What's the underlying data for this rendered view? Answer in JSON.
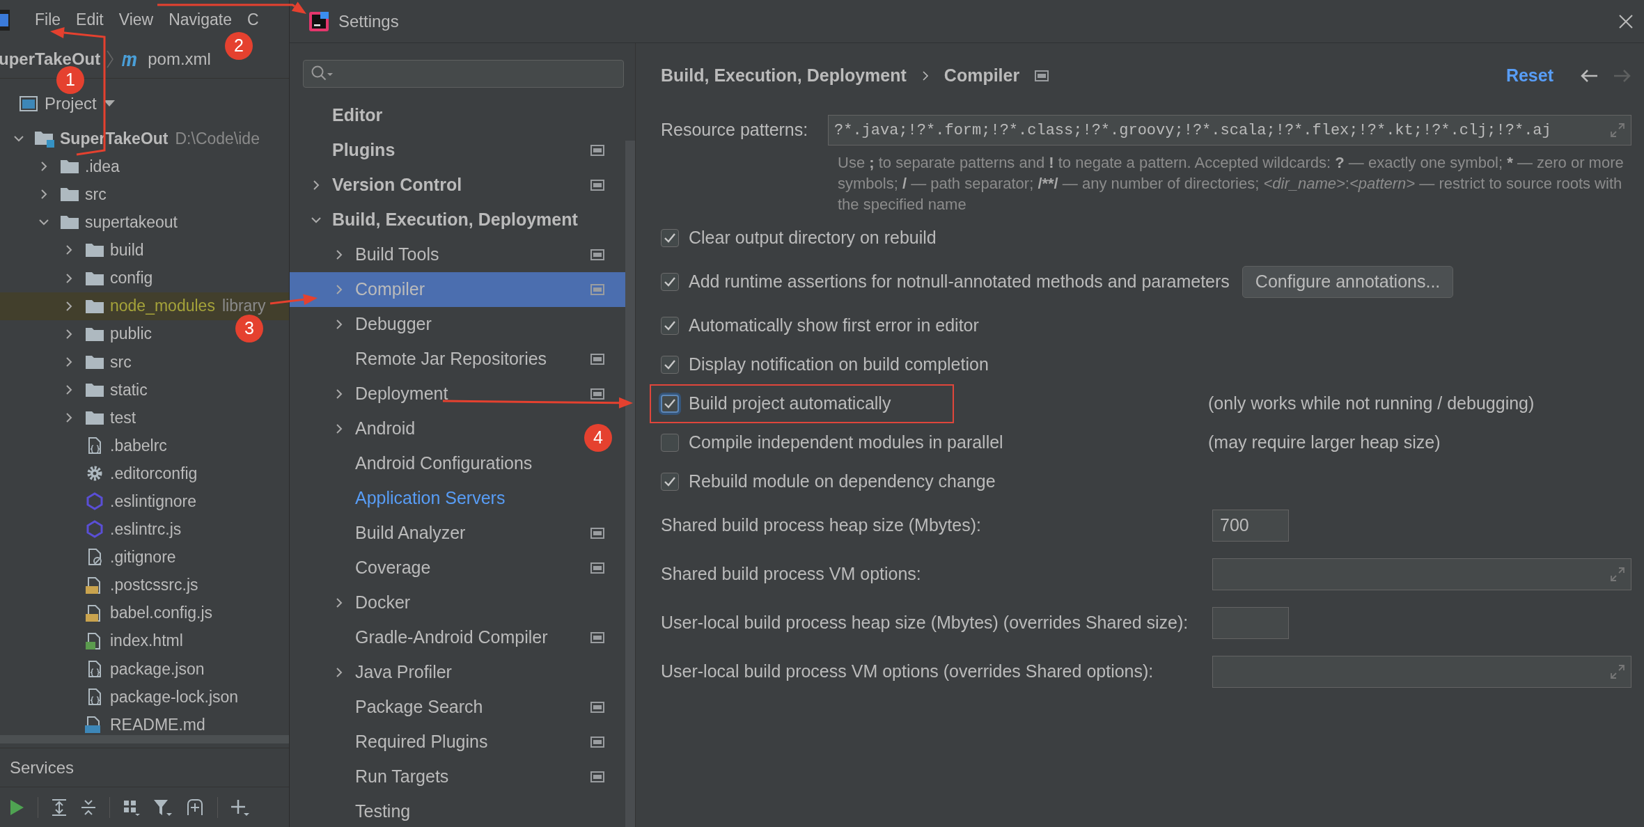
{
  "ide": {
    "menu": [
      "File",
      "Edit",
      "View",
      "Navigate",
      "C"
    ],
    "breadcrumb": {
      "project": "uperTakeOut",
      "file": "pom.xml"
    },
    "project_view": {
      "title": "Project"
    },
    "tree": [
      {
        "name": "SuperTakeOut",
        "path": "D:\\Code\\ide",
        "kind": "module",
        "expanded": true,
        "children": [
          {
            "name": ".idea",
            "kind": "folder",
            "expanded": false
          },
          {
            "name": "src",
            "kind": "folder",
            "expanded": false
          },
          {
            "name": "supertakeout",
            "kind": "folder",
            "expanded": true,
            "children": [
              {
                "name": "build",
                "kind": "folder",
                "expanded": false
              },
              {
                "name": "config",
                "kind": "folder",
                "expanded": false
              },
              {
                "name": "node_modules",
                "note": "library",
                "kind": "library",
                "expanded": false
              },
              {
                "name": "public",
                "kind": "folder",
                "expanded": false
              },
              {
                "name": "src",
                "kind": "folder",
                "expanded": false
              },
              {
                "name": "static",
                "kind": "folder",
                "expanded": false
              },
              {
                "name": "test",
                "kind": "folder",
                "expanded": false
              },
              {
                "name": ".babelrc",
                "kind": "config-file"
              },
              {
                "name": ".editorconfig",
                "kind": "gear"
              },
              {
                "name": ".eslintignore",
                "kind": "eslint"
              },
              {
                "name": ".eslintrc.js",
                "kind": "eslint"
              },
              {
                "name": ".gitignore",
                "kind": "ignore-file"
              },
              {
                "name": ".postcssrc.js",
                "kind": "js-file"
              },
              {
                "name": "babel.config.js",
                "kind": "js-file"
              },
              {
                "name": "index.html",
                "kind": "html-file"
              },
              {
                "name": "package.json",
                "kind": "config-file"
              },
              {
                "name": "package-lock.json",
                "kind": "config-file"
              },
              {
                "name": "README.md",
                "kind": "md-file"
              }
            ]
          }
        ]
      }
    ],
    "services": {
      "title": "Services"
    }
  },
  "dialog": {
    "title": "Settings",
    "sidebar": [
      {
        "label": "Editor",
        "bold": true,
        "scoped": false,
        "selected": false,
        "modified": false
      },
      {
        "label": "Plugins",
        "bold": true,
        "scoped": true,
        "selected": false,
        "modified": false
      },
      {
        "label": "Version Control",
        "bold": true,
        "scoped": true,
        "selected": false,
        "modified": false,
        "expanded": false
      },
      {
        "label": "Build, Execution, Deployment",
        "bold": true,
        "scoped": false,
        "selected": false,
        "modified": false,
        "expanded": true,
        "children": [
          {
            "label": "Build Tools",
            "bold": false,
            "scoped": true,
            "selected": false,
            "modified": false,
            "expanded": false
          },
          {
            "label": "Compiler",
            "bold": false,
            "scoped": true,
            "selected": true,
            "modified": false,
            "expanded": false
          },
          {
            "label": "Debugger",
            "bold": false,
            "scoped": false,
            "selected": false,
            "modified": false,
            "expanded": false
          },
          {
            "label": "Remote Jar Repositories",
            "bold": false,
            "scoped": true,
            "selected": false,
            "modified": false
          },
          {
            "label": "Deployment",
            "bold": false,
            "scoped": true,
            "selected": false,
            "modified": false,
            "expanded": false
          },
          {
            "label": "Android",
            "bold": false,
            "scoped": false,
            "selected": false,
            "modified": false,
            "expanded": false
          },
          {
            "label": "Android Configurations",
            "bold": false,
            "scoped": false,
            "selected": false,
            "modified": false
          },
          {
            "label": "Application Servers",
            "bold": false,
            "scoped": false,
            "selected": false,
            "modified": true
          },
          {
            "label": "Build Analyzer",
            "bold": false,
            "scoped": true,
            "selected": false,
            "modified": false
          },
          {
            "label": "Coverage",
            "bold": false,
            "scoped": true,
            "selected": false,
            "modified": false
          },
          {
            "label": "Docker",
            "bold": false,
            "scoped": false,
            "selected": false,
            "modified": false,
            "expanded": false
          },
          {
            "label": "Gradle-Android Compiler",
            "bold": false,
            "scoped": true,
            "selected": false,
            "modified": false
          },
          {
            "label": "Java Profiler",
            "bold": false,
            "scoped": false,
            "selected": false,
            "modified": false,
            "expanded": false
          },
          {
            "label": "Package Search",
            "bold": false,
            "scoped": true,
            "selected": false,
            "modified": false
          },
          {
            "label": "Required Plugins",
            "bold": false,
            "scoped": true,
            "selected": false,
            "modified": false
          },
          {
            "label": "Run Targets",
            "bold": false,
            "scoped": true,
            "selected": false,
            "modified": false
          },
          {
            "label": "Testing",
            "bold": false,
            "scoped": false,
            "selected": false,
            "modified": false
          }
        ]
      }
    ],
    "page": {
      "breadcrumb": [
        "Build, Execution, Deployment",
        "Compiler"
      ],
      "reset": "Reset",
      "back_disabled": false,
      "forward_disabled": true,
      "resource_patterns": {
        "label": "Resource patterns:",
        "value": "?*.java;!?*.form;!?*.class;!?*.groovy;!?*.scala;!?*.flex;!?*.kt;!?*.clj;!?*.aj",
        "hint": [
          {
            "kind": "plain",
            "text": "Use "
          },
          {
            "kind": "bold",
            "text": ";"
          },
          {
            "kind": "plain",
            "text": " to separate patterns and "
          },
          {
            "kind": "bold",
            "text": "!"
          },
          {
            "kind": "plain",
            "text": " to negate a pattern. Accepted wildcards: "
          },
          {
            "kind": "bold",
            "text": "?"
          },
          {
            "kind": "plain",
            "text": " — exactly one symbol; "
          },
          {
            "kind": "bold",
            "text": "*"
          },
          {
            "kind": "plain",
            "text": " — zero or more symbols; "
          },
          {
            "kind": "bold",
            "text": "/"
          },
          {
            "kind": "plain",
            "text": " — path separator; "
          },
          {
            "kind": "bold",
            "text": "/**/"
          },
          {
            "kind": "plain",
            "text": " — any number of directories; "
          },
          {
            "kind": "italic",
            "text": "<dir_name>"
          },
          {
            "kind": "plain",
            "text": ":"
          },
          {
            "kind": "italic",
            "text": "<pattern>"
          },
          {
            "kind": "plain",
            "text": " — restrict to source roots with the specified name"
          }
        ]
      },
      "options": [
        {
          "label": "Clear output directory on rebuild",
          "checked": true,
          "focused": false,
          "outlined": false
        },
        {
          "label": "Add runtime assertions for notnull-annotated methods and parameters",
          "checked": true,
          "focused": false,
          "outlined": false,
          "button": "Configure annotations..."
        },
        {
          "label": "Automatically show first error in editor",
          "checked": true,
          "focused": false,
          "outlined": false
        },
        {
          "label": "Display notification on build completion",
          "checked": true,
          "focused": false,
          "outlined": false
        },
        {
          "label": "Build project automatically",
          "checked": true,
          "focused": true,
          "outlined": true,
          "note": "(only works while not running / debugging)"
        },
        {
          "label": "Compile independent modules in parallel",
          "checked": false,
          "focused": false,
          "outlined": false,
          "note": "(may require larger heap size)"
        },
        {
          "label": "Rebuild module on dependency change",
          "checked": true,
          "focused": false,
          "outlined": false
        }
      ],
      "fields": [
        {
          "label": "Shared build process heap size (Mbytes):",
          "kind": "number",
          "value": "700"
        },
        {
          "label": "Shared build process VM options:",
          "kind": "expandable"
        },
        {
          "label": "User-local build process heap size (Mbytes) (overrides Shared size):",
          "kind": "number"
        },
        {
          "label": "User-local build process VM options (overrides Shared options):",
          "kind": "expandable"
        }
      ]
    }
  },
  "annotations": {
    "markers": [
      "1",
      "2",
      "3",
      "4"
    ]
  }
}
